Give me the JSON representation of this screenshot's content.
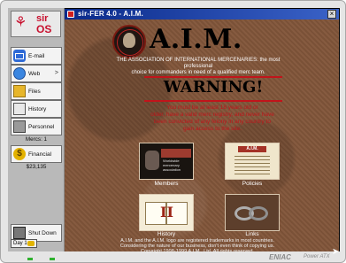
{
  "os": {
    "logo_line1": "sir",
    "logo_line2": "OS"
  },
  "sidebar": {
    "items": [
      {
        "label": "E-mail"
      },
      {
        "label": "Web",
        "chevron": ">"
      },
      {
        "label": "Files"
      },
      {
        "label": "History"
      },
      {
        "label": "Personnel"
      },
      {
        "label": "Financial"
      },
      {
        "label": "Shut Down"
      }
    ],
    "mercs": "Mercs: 1",
    "money": "$23,135",
    "day": "Day 1"
  },
  "window": {
    "title": "sir-FER 4.0  -  A.I.M.",
    "close": "×"
  },
  "page": {
    "brand_title": "A.I.M.",
    "intro": [
      "THE ASSOCIATION OF INTERNATIONAL MERCENARIES: the most professional",
      "choice for commanders in need of a qualified merc team."
    ],
    "warning_title": "WARNING!",
    "warning_body": [
      "You must be at least 18 years old or",
      "older, have a valid merc registry, and never have",
      "been convicted of any felony in any country to",
      "gain access to the site."
    ],
    "tiles": {
      "members": {
        "label": "Members",
        "logo_text": "A.I.M.",
        "caption": "Worldwide mercenary association"
      },
      "policies": {
        "label": "Policies",
        "logo_text": "A.I.M."
      },
      "history": {
        "label": "History",
        "numeral": "II"
      },
      "links": {
        "label": "Links"
      }
    },
    "footer": [
      "A.I.M. and the A.I.M. logo are registered trademarks in most countries.",
      "Considering the nature of our business, don't even think of copying us.",
      "Copyright 1998-1999 A.I.M., Ltd. All rights reserved."
    ]
  },
  "monitor": {
    "brand": "ENIAC",
    "model": "Power ATX"
  }
}
